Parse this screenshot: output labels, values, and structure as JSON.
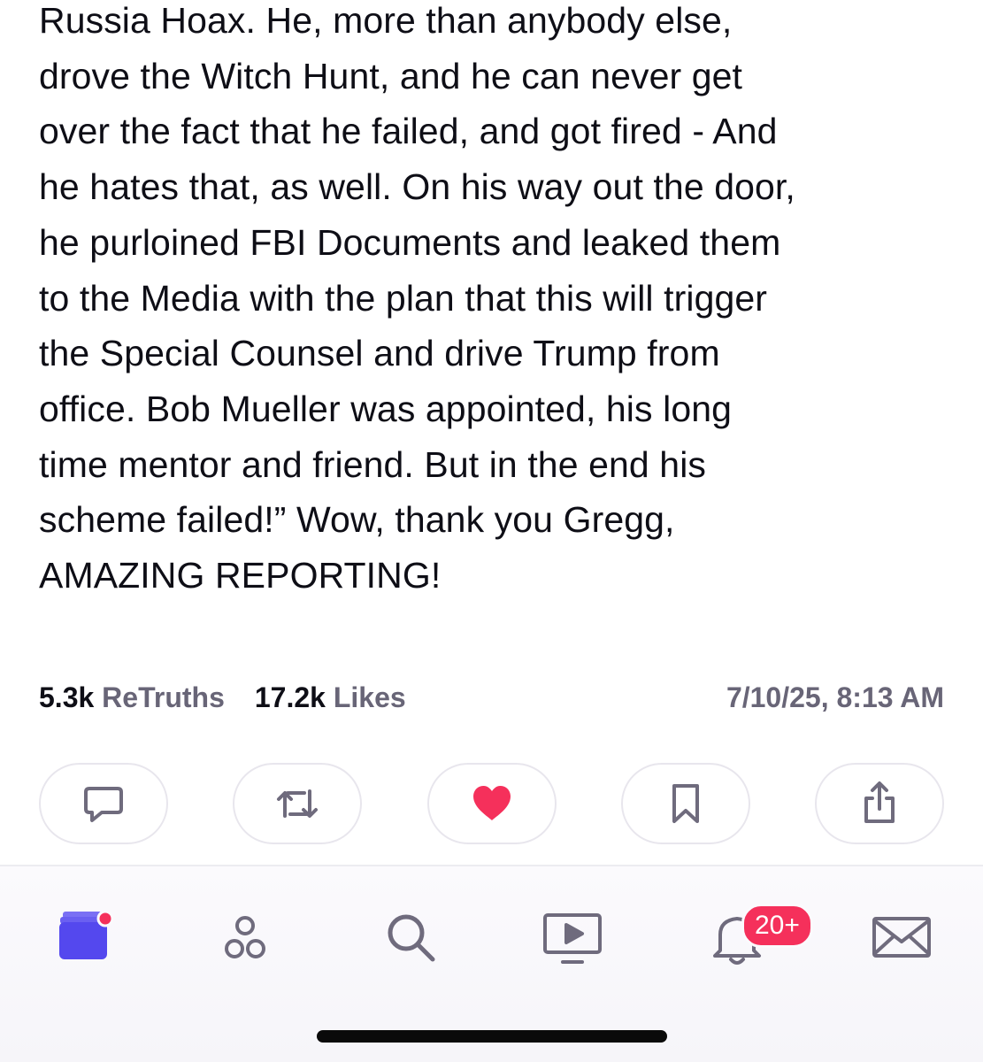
{
  "post": {
    "lines": [
      "Russia Hoax. He, more than anybody else,",
      "drove the Witch Hunt, and he can never get",
      "over the fact that he failed, and got fired - And",
      "he hates that, as well. On his way out the door,",
      "he purloined FBI Documents and leaked them",
      "to the Media with the plan that this will trigger",
      "the Special Counsel and drive Trump from",
      "office. Bob Mueller was appointed, his long",
      "time mentor and friend. But in the end his",
      "scheme failed!” Wow, thank you Gregg,",
      "AMAZING REPORTING!"
    ]
  },
  "stats": {
    "retruths_count": "5.3k",
    "retruths_label": "ReTruths",
    "likes_count": "17.2k",
    "likes_label": "Likes",
    "timestamp": "7/10/25, 8:13 AM"
  },
  "actions": {
    "reply_icon": "speech-bubble-icon",
    "retruth_icon": "repost-arrows-icon",
    "like_icon": "heart-icon",
    "bookmark_icon": "bookmark-icon",
    "share_icon": "share-icon",
    "like_active": true
  },
  "tabbar": {
    "notifications_badge": "20+",
    "tabs": [
      "home-feed-icon",
      "groups-icon",
      "search-icon",
      "video-icon",
      "bell-icon",
      "mail-icon"
    ]
  },
  "colors": {
    "accent": "#5448ee",
    "heart": "#f5305b",
    "icon_gray": "#6f6b7d",
    "text_secondary": "#686577"
  }
}
